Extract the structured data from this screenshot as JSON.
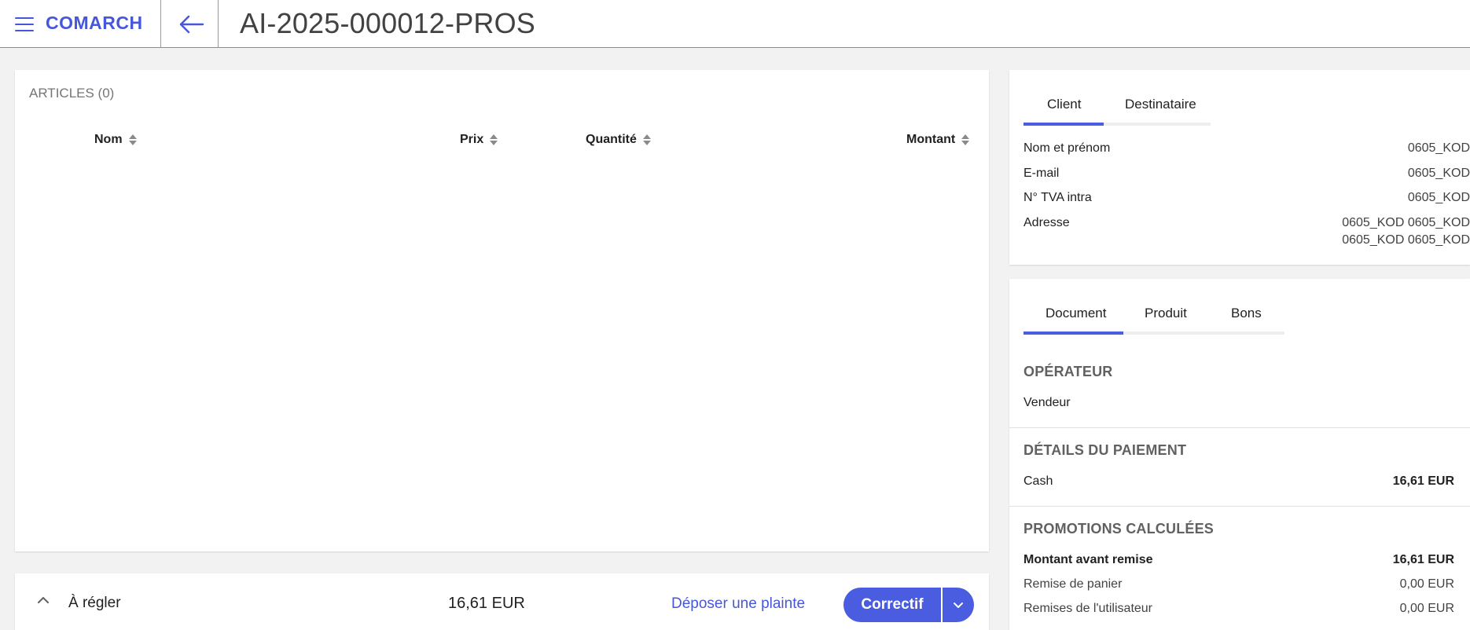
{
  "header": {
    "logo": "COMARCH",
    "title": "AI-2025-000012-PROS"
  },
  "articles": {
    "title": "ARTICLES (0)",
    "columns": [
      "Nom",
      "Prix",
      "Quantité",
      "Montant"
    ]
  },
  "bottom": {
    "label": "À régler",
    "amount": "16,61 EUR",
    "complaint_link": "Déposer une plainte",
    "primary_button": "Correctif"
  },
  "client_panel": {
    "tabs": [
      "Client",
      "Destinataire"
    ],
    "rows": [
      {
        "label": "Nom et prénom",
        "value": "0605_KOD"
      },
      {
        "label": "E-mail",
        "value": "0605_KOD"
      },
      {
        "label": "N° TVA intra",
        "value": "0605_KOD"
      },
      {
        "label": "Adresse",
        "value_lines": [
          "0605_KOD 0605_KOD",
          "0605_KOD 0605_KOD"
        ]
      }
    ]
  },
  "document_panel": {
    "tabs": [
      "Document",
      "Produit",
      "Bons"
    ],
    "operator": {
      "title": "OPÉRATEUR",
      "value": "Vendeur"
    },
    "payment": {
      "title": "DÉTAILS DU PAIEMENT",
      "rows": [
        {
          "label": "Cash",
          "value": "16,61 EUR"
        }
      ]
    },
    "promotions": {
      "title": "PROMOTIONS CALCULÉES",
      "rows": [
        {
          "label": "Montant avant remise",
          "value": "16,61 EUR"
        },
        {
          "label": "Remise de panier",
          "value": "0,00 EUR"
        },
        {
          "label": "Remises de l'utilisateur",
          "value": "0,00 EUR"
        }
      ]
    }
  },
  "colors": {
    "accent": "#4a5ce0",
    "background": "#f2f2f2",
    "card": "#ffffff"
  },
  "icons": [
    "menu-icon",
    "arrow-left-icon",
    "sort-icon",
    "chevron-up-icon",
    "chevron-down-icon"
  ]
}
